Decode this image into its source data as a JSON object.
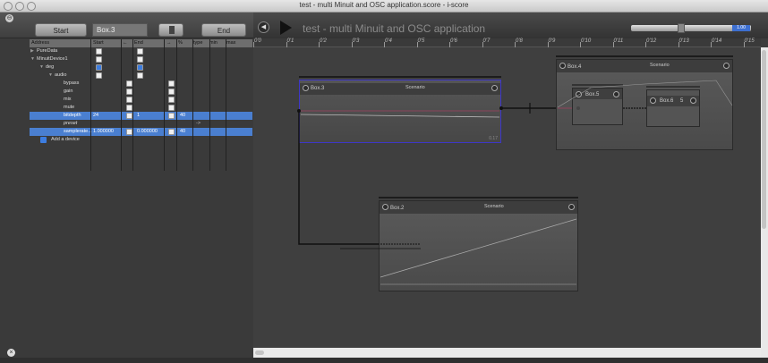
{
  "window": {
    "title": "test - multi Minuit and OSC application.score - i-score"
  },
  "left": {
    "start_label": "Start",
    "end_label": "End",
    "selected_box": "Box.3",
    "headers": [
      "Address",
      "Start",
      "←",
      "End",
      "→",
      "%",
      "type",
      "min",
      "max"
    ],
    "rows": [
      {
        "label": "PureData",
        "indent": 0
      },
      {
        "label": "MinuitDevice1",
        "indent": 0
      },
      {
        "label": "deg",
        "indent": 1
      },
      {
        "label": "audio",
        "indent": 2
      },
      {
        "label": "bypass",
        "indent": 3
      },
      {
        "label": "gain",
        "indent": 3
      },
      {
        "label": "mix",
        "indent": 3
      },
      {
        "label": "mute",
        "indent": 3
      },
      {
        "label": "bitdepth",
        "indent": 3,
        "start": "24",
        "end": "1",
        "pct": "40",
        "selected": true
      },
      {
        "label": "preset",
        "indent": 3,
        "arrow": "->",
        "italic": true
      },
      {
        "label": "samplerate...",
        "indent": 3,
        "start": "1.000000",
        "end": "0.000000",
        "pct": "40",
        "selected": true
      },
      {
        "label": "Add a device",
        "indent": 0
      }
    ]
  },
  "score": {
    "title": "test - multi Minuit and OSC application",
    "zoom_value": "1.00",
    "ruler_ticks": [
      "0'0",
      "0'1",
      "0'2",
      "0'3",
      "0'4",
      "0'5",
      "0'6",
      "0'7",
      "0'8",
      "0'9",
      "0'10",
      "0'11",
      "0'12",
      "0'13",
      "0'14",
      "0'15"
    ],
    "boxes": {
      "box3": {
        "name": "Box.3",
        "type": "Scenario",
        "progress": "0.17"
      },
      "box4": {
        "name": "Box.4",
        "type": "Scenario"
      },
      "box5": {
        "name": "Box.5"
      },
      "box6": {
        "name": "Box.6",
        "extra": "5"
      },
      "box2": {
        "name": "Box.2",
        "type": "Scenario"
      }
    }
  },
  "colors": {
    "selection": "#4a7fd0",
    "box3_border": "#3d36c8",
    "accent": "#3d6fd0"
  }
}
